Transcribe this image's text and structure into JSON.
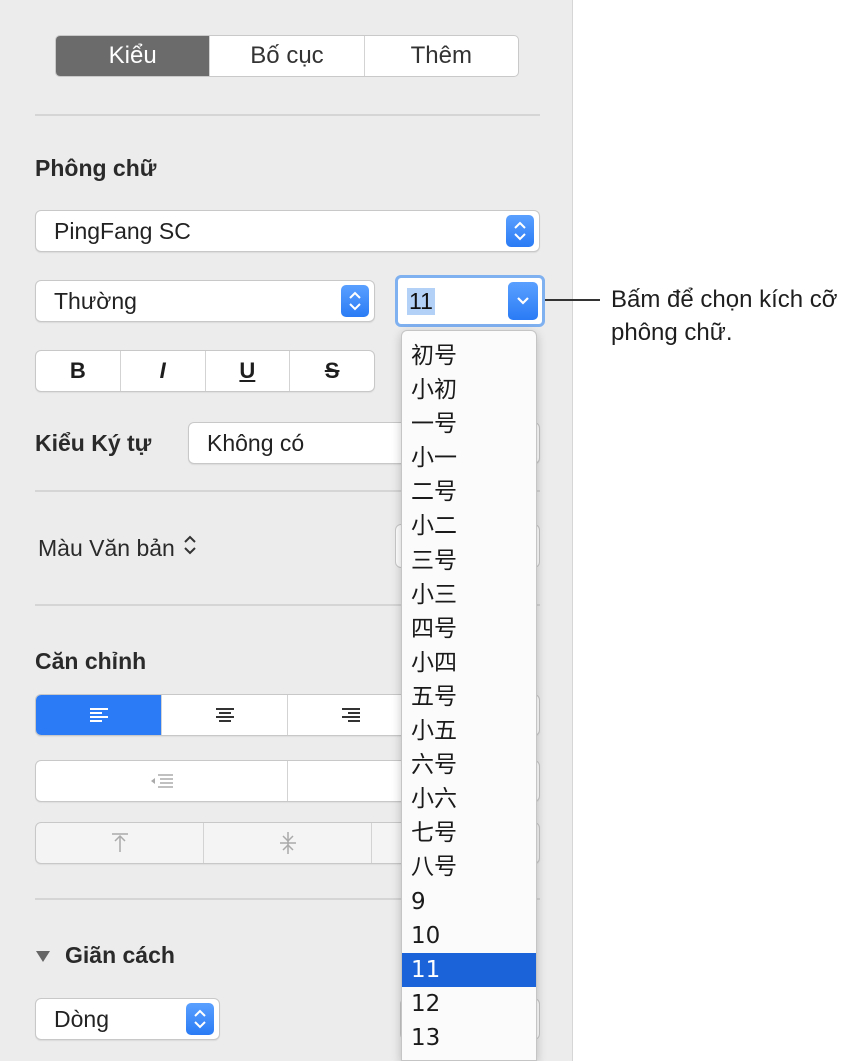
{
  "tabs": [
    "Kiểu",
    "Bố cục",
    "Thêm"
  ],
  "font_section": {
    "heading": "Phông chữ",
    "family": "PingFang SC",
    "style": "Thường",
    "size": "11",
    "bold": "B",
    "italic": "I",
    "underline": "U",
    "strike": "S"
  },
  "char_style": {
    "label": "Kiểu Ký tự",
    "value": "Không có"
  },
  "text_color": {
    "label": "Màu Văn bản"
  },
  "alignment": {
    "heading": "Căn chỉnh"
  },
  "spacing": {
    "heading": "Giãn cách",
    "value": "Dòng"
  },
  "size_menu": {
    "items": [
      "初号",
      "小初",
      "一号",
      "小一",
      "二号",
      "小二",
      "三号",
      "小三",
      "四号",
      "小四",
      "五号",
      "小五",
      "六号",
      "小六",
      "七号",
      "八号",
      "9",
      "10",
      "11",
      "12",
      "13"
    ],
    "selected_index": 18
  },
  "callout": {
    "text": "Bấm để chọn kích cỡ phông chữ."
  },
  "colors": {
    "accent": "#2a7bf5",
    "selection": "#1b63d8",
    "panel": "#ececec"
  }
}
